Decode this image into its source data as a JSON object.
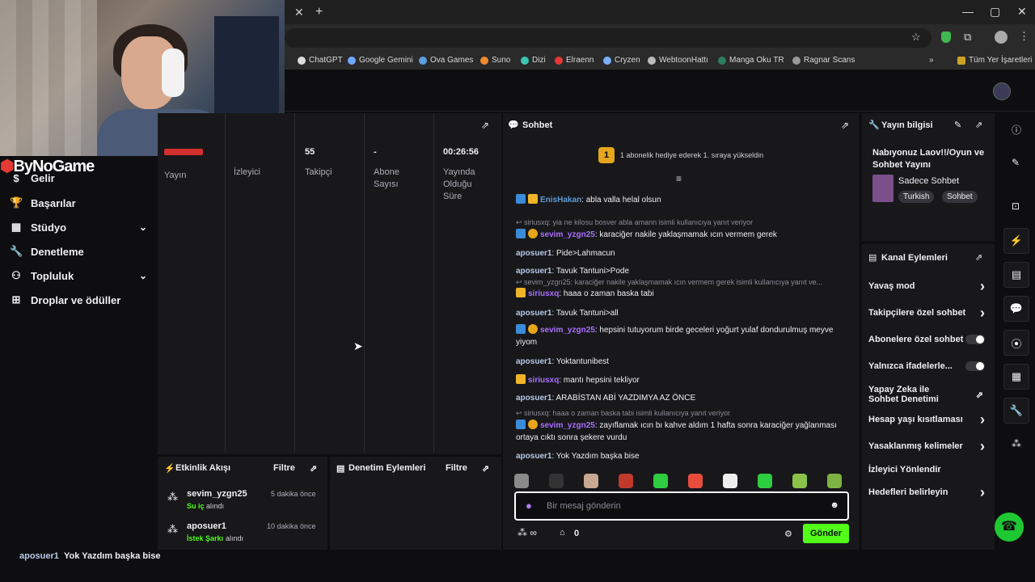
{
  "browser": {
    "bookmarks": [
      "ChatGPT",
      "Google Gemini",
      "Ova Games",
      "Suno",
      "Dizi",
      "Elraenn",
      "Cryzen",
      "WebtoonHattı",
      "Manga Oku TR",
      "Ragnar Scans",
      "Tüm Yer İşaretleri"
    ]
  },
  "sidebar": {
    "logo": "ByNoGame",
    "items": [
      {
        "label": "Gelir",
        "icon": "dollar-icon"
      },
      {
        "label": "Başarılar",
        "icon": "trophy-icon"
      },
      {
        "label": "Stüdyo",
        "icon": "studio-icon"
      },
      {
        "label": "Denetleme",
        "icon": "wrench-icon"
      },
      {
        "label": "Topluluk",
        "icon": "community-icon"
      },
      {
        "label": "Droplar ve ödüller",
        "icon": "gift-icon"
      }
    ]
  },
  "stats": {
    "cols": [
      {
        "value": "",
        "label": "Yayın"
      },
      {
        "value": "",
        "label": "İzleyici"
      },
      {
        "value": "55",
        "label": "Takipçi"
      },
      {
        "value": "-",
        "label": "Abone Sayısı"
      },
      {
        "value": "00:26:56",
        "label": "Yayında Olduğu Süre"
      }
    ]
  },
  "chat": {
    "title": "Sohbet",
    "banner_count": "1",
    "banner_text": "1 abonelik hediye ederek 1. sıraya yükseldin",
    "placeholder": "Bir mesaj gönderin",
    "send": "Gönder",
    "points": "0",
    "messages": [
      {
        "type": "msg",
        "user": "EnisHakan",
        "color": "#5b9bd5",
        "text": ": abla valla helal olsun"
      },
      {
        "type": "reply",
        "text": "siriusxq: yia ne kilosu bosver abla amann isimli kullanıcıya yanıt veriyor"
      },
      {
        "type": "msg",
        "user": "sevim_yzgn25",
        "color": "#a970ff",
        "text": ": karaciğer nakile yaklaşmamak ıcın vermem gerek"
      },
      {
        "type": "msg",
        "user": "aposuer1",
        "color": "#b6c8e8",
        "text": ": Pide>Lahmacun"
      },
      {
        "type": "msg",
        "user": "aposuer1",
        "color": "#b6c8e8",
        "text": ": Tavuk Tantuni>Pode"
      },
      {
        "type": "reply",
        "text": "sevim_yzgn25: karaciğer nakile yaklaşmamak ıcın vermem gerek isimli kullanıcıya yanıt ve..."
      },
      {
        "type": "msg",
        "user": "siriusxq",
        "color": "#a970ff",
        "text": ": haaa o zaman baska tabi"
      },
      {
        "type": "msg",
        "user": "aposuer1",
        "color": "#b6c8e8",
        "text": ": Tavuk Tantuni>all"
      },
      {
        "type": "msg",
        "user": "sevim_yzgn25",
        "color": "#a970ff",
        "text": ": hepsini tutuyorum birde geceleri yoğurt yulaf dondurulmuş meyve yiyom"
      },
      {
        "type": "msg",
        "user": "aposuer1",
        "color": "#b6c8e8",
        "text": ": Yoktantunibest"
      },
      {
        "type": "msg",
        "user": "siriusxq",
        "color": "#a970ff",
        "text": ": mantı hepsini tekliyor"
      },
      {
        "type": "msg",
        "user": "aposuer1",
        "color": "#b6c8e8",
        "text": ": ARABİSTAN ABİ YAZDIMYA AZ ÖNCE"
      },
      {
        "type": "reply",
        "text": "siriusxq: haaa o zaman baska tabi isimli kullanıcıya yanıt veriyor"
      },
      {
        "type": "msg",
        "user": "sevim_yzgn25",
        "color": "#a970ff",
        "text": ": zayıflamak ıcın bı kahve aldım 1 hafta sonra karaciğer yağlanması ortaya cıktı sonra şekere vurdu"
      },
      {
        "type": "msg",
        "user": "aposuer1",
        "color": "#b6c8e8",
        "text": ": Yok Yazdım başka bise"
      }
    ]
  },
  "stream_info": {
    "title": "Yayın bilgisi",
    "stream_title": "Nabıyonuz Laov!!/Oyun ve Sohbet Yayını",
    "category": "Sadece Sohbet",
    "tags": [
      "Turkish",
      "Sohbet"
    ]
  },
  "channel_actions": {
    "title": "Kanal Eylemleri",
    "items": [
      {
        "label": "Yavaş mod",
        "kind": "chevron"
      },
      {
        "label": "Takipçilere özel sohbet",
        "kind": "chevron"
      },
      {
        "label": "Abonelere özel sohbet",
        "kind": "toggle"
      },
      {
        "label": "Yalnızca ifadelerle...",
        "kind": "toggle"
      },
      {
        "label": "Yapay Zeka ile Sohbet Denetimi",
        "kind": "external"
      },
      {
        "label": "Hesap yaşı kısıtlaması",
        "kind": "chevron"
      },
      {
        "label": "Yasaklanmış kelimeler",
        "kind": "chevron"
      },
      {
        "label": "İzleyici Yönlendir",
        "kind": "none"
      },
      {
        "label": "Hedefleri belirleyin",
        "kind": "chevron"
      }
    ]
  },
  "activity": {
    "title": "Etkinlik Akışı",
    "filter": "Filtre",
    "events": [
      {
        "user": "sevim_yzgn25",
        "time": "5 dakika önce",
        "reward": "Su iç",
        "suffix": "alındı"
      },
      {
        "user": "aposuer1",
        "time": "10 dakika önce",
        "reward": "İstek Şarkı",
        "suffix": "alındı"
      }
    ]
  },
  "mod_actions": {
    "title": "Denetim Eylemleri",
    "filter": "Filtre"
  },
  "bottom": {
    "user": "aposuer1",
    "text": "Yok Yazdım başka bise"
  }
}
